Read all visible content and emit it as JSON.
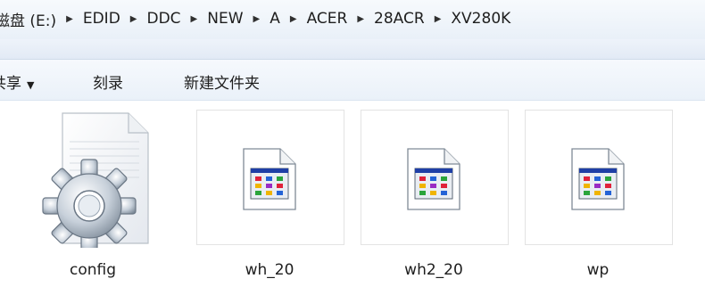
{
  "breadcrumb": {
    "items": [
      "磁盘 (E:)",
      "EDID",
      "DDC",
      "NEW",
      "A",
      "ACER",
      "28ACR",
      "XV280K"
    ]
  },
  "toolbar": {
    "share_label": "共享",
    "burn_label": "刻录",
    "new_folder_label": "新建文件夹"
  },
  "files": [
    {
      "name": "config",
      "icon": "config-settings-icon"
    },
    {
      "name": "wh_20",
      "icon": "application-file-icon"
    },
    {
      "name": "wh2_20",
      "icon": "application-file-icon"
    },
    {
      "name": "wp",
      "icon": "application-file-icon"
    }
  ],
  "colors": {
    "accent": "#1e4fa3",
    "chrome": "#e9f0f8"
  }
}
